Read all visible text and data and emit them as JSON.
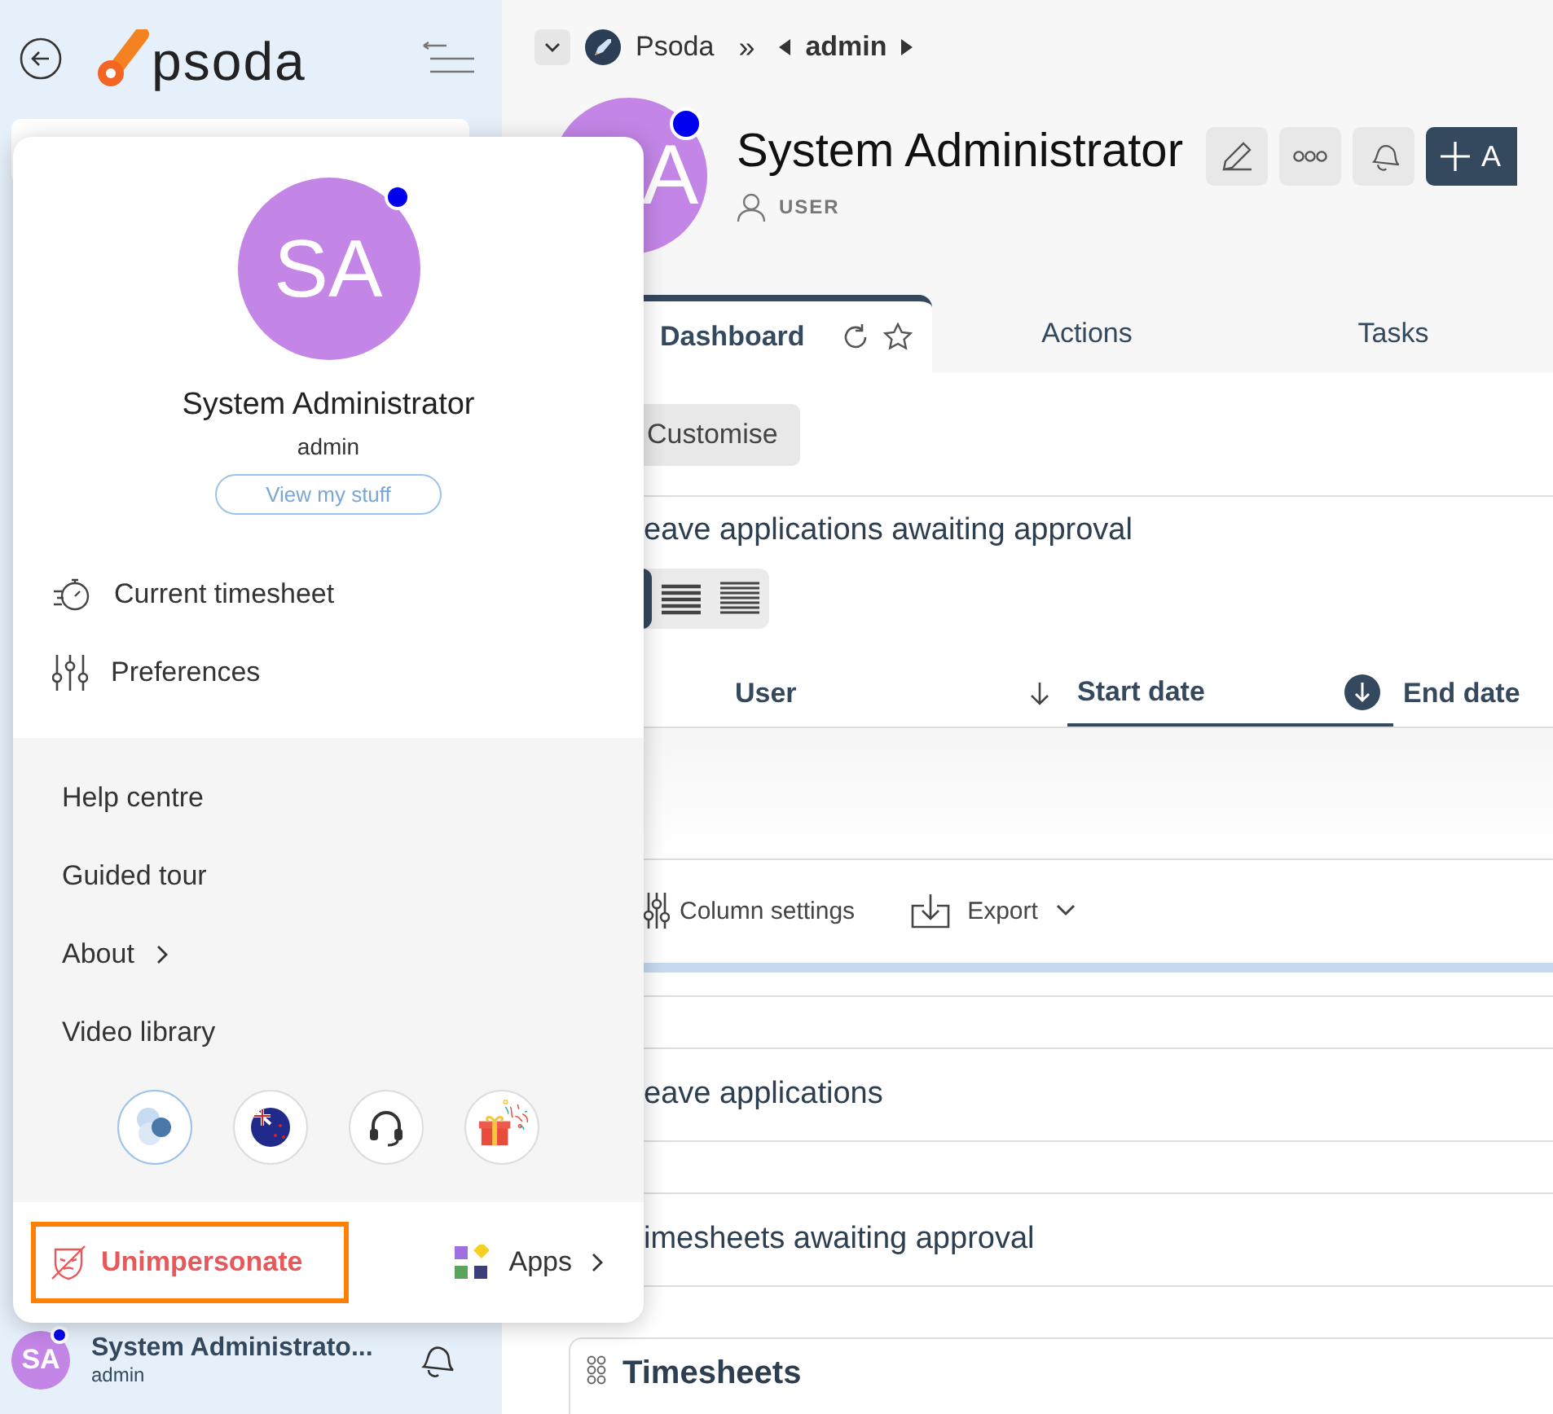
{
  "sidebar": {
    "logo": "psoda",
    "user": {
      "initials": "SA",
      "online": true,
      "name": "System Administrato...",
      "username": "admin"
    }
  },
  "breadcrumb": {
    "app": "Psoda",
    "separator": "»",
    "current": "admin"
  },
  "header": {
    "avatar_initial": "A",
    "online": true,
    "title": "System Administrator",
    "role": "USER",
    "add_button": "A"
  },
  "tabs": [
    {
      "label": "Dashboard",
      "selected": true
    },
    {
      "label": "Actions",
      "selected": false
    },
    {
      "label": "Tasks",
      "selected": false
    }
  ],
  "customise_button": "Customise",
  "leave_widget": {
    "title": "eave applications awaiting approval",
    "density_modes": [
      {
        "selected": true
      },
      {
        "selected": false
      },
      {
        "selected": false
      }
    ],
    "columns": [
      {
        "label": "User",
        "sorted": false
      },
      {
        "label": "Start date",
        "sorted": true
      },
      {
        "label": "End date"
      }
    ],
    "toolbar": {
      "column_settings": "Column settings",
      "export": "Export"
    }
  },
  "collapsed_widgets": [
    "eave applications",
    "imesheets awaiting approval"
  ],
  "timesheets_card": "Timesheets",
  "popup": {
    "initials": "SA",
    "online": true,
    "name": "System Administrator",
    "username": "admin",
    "view_button": "View my stuff",
    "menu": [
      {
        "label": "Current timesheet",
        "kind": "timesheet"
      },
      {
        "label": "Preferences",
        "kind": "preferences"
      }
    ],
    "links": [
      {
        "label": "Help centre",
        "submenu": false
      },
      {
        "label": "Guided tour",
        "submenu": false
      },
      {
        "label": "About",
        "submenu": true
      },
      {
        "label": "Video library",
        "submenu": false
      }
    ],
    "unimpersonate": {
      "label": "Unimpersonate",
      "highlighted": true
    },
    "apps": "Apps"
  }
}
